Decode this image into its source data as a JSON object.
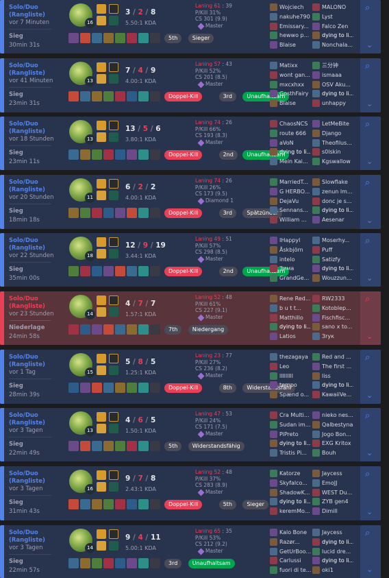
{
  "colors": {
    "win_bg": "#28344e",
    "loss_bg": "#59343b",
    "win_accent": "#5383e8",
    "loss_accent": "#e84057",
    "badge_red": "#e84057",
    "badge_grey": "#4a4b57",
    "badge_green": "#00a54e"
  },
  "icons": {
    "expand": "chevron-down-icon",
    "spy": "magnify-spy-icon"
  },
  "matches": [
    {
      "outcome": "win",
      "queue": "Solo/Duo",
      "queue2": "(Rangliste)",
      "ago": "vor 7 Minuten",
      "result": "Sieg",
      "duration": "30min 31s",
      "level": "16",
      "k": "3",
      "d": "2",
      "a": "8",
      "kda": "5.50:1 KDA",
      "lane_label": "Laning 61",
      "lane_rest": " : 39",
      "pkill": "P/Kill 31%",
      "cs": "CS 301 (9.9)",
      "rank": "Master",
      "tags": [
        {
          "label": "5th",
          "style": "grey"
        },
        {
          "label": "Sieger",
          "style": "grey"
        }
      ],
      "team1": [
        "Wojciech",
        "nakuhe790",
        "Emissary...",
        "hewwo p...",
        "Blaise"
      ],
      "team2": [
        "MALONO",
        "Lyst",
        "Falco Zen",
        "dying to li...",
        "Nonchala..."
      ],
      "me_index": 3
    },
    {
      "outcome": "win",
      "queue": "Solo/Duo",
      "queue2": "(Rangliste)",
      "ago": "vor 41 Minuten",
      "result": "Sieg",
      "duration": "23min 31s",
      "level": "13",
      "k": "7",
      "d": "4",
      "a": "9",
      "kda": "4.00:1 KDA",
      "lane_label": "Laning 57",
      "lane_rest": " : 43",
      "pkill": "P/Kill 52%",
      "cs": "CS 201 (8.5)",
      "rank": "Master",
      "tags": [
        {
          "label": "Doppel-Kill",
          "style": "red"
        },
        {
          "label": "3rd",
          "style": "grey"
        },
        {
          "label": "Unaufhaltsam",
          "style": "green"
        }
      ],
      "team1": [
        "Matixx",
        "wont gan...",
        "mxcxhxx",
        "GosthFairy",
        "Blaise"
      ],
      "team2": [
        "三分钟",
        "ismaaa",
        "OSV Aku...",
        "dying to li...",
        "unhappy"
      ],
      "me_index": 3
    },
    {
      "outcome": "win",
      "queue": "Solo/Duo",
      "queue2": "(Rangliste)",
      "ago": "vor 18 Stunden",
      "result": "Sieg",
      "duration": "23min 11s",
      "level": "13",
      "k": "13",
      "d": "5",
      "a": "6",
      "kda": "3.80:1 KDA",
      "lane_label": "Laning 74",
      "lane_rest": " : 26",
      "pkill": "P/Kill 66%",
      "cs": "CS 193 (8.3)",
      "rank": "Master",
      "tags": [
        {
          "label": "Doppel-Kill",
          "style": "red"
        },
        {
          "label": "2nd",
          "style": "grey"
        },
        {
          "label": "Unaufhaltsam",
          "style": "green"
        }
      ],
      "team1": [
        "ChaosNCS",
        "route 666",
        "aVoN",
        "dying to li...",
        "Mein Kai..."
      ],
      "team2": [
        "LetMeBite",
        "Django",
        "Theofilus...",
        "s0lskin",
        "Kgswallow"
      ],
      "me_index": 3
    },
    {
      "outcome": "win",
      "queue": "Solo/Duo",
      "queue2": "(Rangliste)",
      "ago": "vor 20 Stunden",
      "result": "Sieg",
      "duration": "18min 18s",
      "level": "11",
      "k": "6",
      "d": "2",
      "a": "2",
      "kda": "4.00:1 KDA",
      "lane_label": "Laning 74",
      "lane_rest": " : 26",
      "pkill": "P/Kill 26%",
      "cs": "CS 173 (9.5)",
      "rank": "Diamond 1",
      "tags": [
        {
          "label": "Doppel-Kill",
          "style": "red"
        },
        {
          "label": "3rd",
          "style": "grey"
        },
        {
          "label": "Spätzünder",
          "style": "grey"
        }
      ],
      "team1": [
        "MarriedT...",
        "G HERBO...",
        "DejaVu",
        "Sennans...",
        "William ..."
      ],
      "team2": [
        "Slowflake",
        "zenun lm...",
        "donc je s...",
        "dying to li...",
        "Aesenar"
      ],
      "me_index": 3
    },
    {
      "outcome": "win",
      "queue": "Solo/Duo",
      "queue2": "(Rangliste)",
      "ago": "vor 22 Stunden",
      "result": "Sieg",
      "duration": "35min 00s",
      "level": "18",
      "k": "12",
      "d": "9",
      "a": "19",
      "kda": "3.44:1 KDA",
      "lane_label": "Laning 49",
      "lane_rest": " : 51",
      "pkill": "P/Kill 57%",
      "cs": "CS 298 (8.5)",
      "rank": "Master",
      "tags": [
        {
          "label": "Doppel-Kill",
          "style": "red"
        },
        {
          "label": "2nd",
          "style": "grey"
        },
        {
          "label": "Unaufhaltsam",
          "style": "green"
        }
      ],
      "team1": [
        "IHappyl",
        "Åskbjörn",
        "intelo",
        "Зима",
        "GrandGe..."
      ],
      "team2": [
        "Moserhy...",
        "Puff",
        "Satizfy",
        "dying to li...",
        "Wouzzun..."
      ],
      "me_index": 3
    },
    {
      "outcome": "loss",
      "queue": "Solo/Duo",
      "queue2": "(Rangliste)",
      "ago": "vor 23 Stunden",
      "result": "Niederlage",
      "duration": "24min 58s",
      "level": "14",
      "k": "4",
      "d": "7",
      "a": "7",
      "kda": "1.57:1 KDA",
      "lane_label": "Laning 52",
      "lane_rest": " : 48",
      "pkill": "P/Kill 61%",
      "cs": "CS 227 (9.1)",
      "rank": "Master",
      "tags": [
        {
          "label": "7th",
          "style": "grey"
        },
        {
          "label": "Niedergang",
          "style": "grey"
        }
      ],
      "team1": [
        "Rene Red...",
        "b u t t...",
        "Matthillo",
        "dying to li...",
        "Latios"
      ],
      "team2": [
        "RW2333",
        "Kotoblep...",
        "Fischfisc...",
        "sano x to...",
        "Зrук"
      ],
      "me_index": 3
    },
    {
      "outcome": "win",
      "queue": "Solo/Duo",
      "queue2": "(Rangliste)",
      "ago": "vor 1 Tag",
      "result": "Sieg",
      "duration": "28min 39s",
      "level": "15",
      "k": "5",
      "d": "8",
      "a": "5",
      "kda": "1.25:1 KDA",
      "lane_label": "Laning 23",
      "lane_rest": " : 77",
      "pkill": "P/Kill 27%",
      "cs": "CS 236 (8.2)",
      "rank": "Master",
      "tags": [
        {
          "label": "Doppel-Kill",
          "style": "red"
        },
        {
          "label": "8th",
          "style": "grey"
        },
        {
          "label": "Widerstandsfähi",
          "style": "grey"
        }
      ],
      "team1": [
        "thezagaya",
        "Leo",
        "lllllllll",
        "tempo",
        "Spænd o..."
      ],
      "team2": [
        "Red and ...",
        "The first ...",
        "liss",
        "dying to li...",
        "KawaiiVe..."
      ],
      "me_index": 3
    },
    {
      "outcome": "win",
      "queue": "Solo/Duo",
      "queue2": "(Rangliste)",
      "ago": "vor 3 Tagen",
      "result": "Sieg",
      "duration": "22min 49s",
      "level": "13",
      "k": "4",
      "d": "6",
      "a": "5",
      "kda": "1.50:1 KDA",
      "lane_label": "Laning 47",
      "lane_rest": " : 53",
      "pkill": "P/Kill 24%",
      "cs": "CS 171 (7.5)",
      "rank": "Master",
      "tags": [
        {
          "label": "5th",
          "style": "grey"
        },
        {
          "label": "Widerstandsfähig",
          "style": "grey"
        }
      ],
      "team1": [
        "Cra Multi...",
        "Sudan im...",
        "PiPreto",
        "dying to li...",
        "Tristis Pi..."
      ],
      "team2": [
        "nieko nes...",
        "Qalbestyna",
        "Jogo Bon...",
        "EXG Kritox",
        "Bouh"
      ],
      "me_index": 3
    },
    {
      "outcome": "win",
      "queue": "Solo/Duo",
      "queue2": "(Rangliste)",
      "ago": "vor 3 Tagen",
      "result": "Sieg",
      "duration": "31min 43s",
      "level": "16",
      "k": "9",
      "d": "7",
      "a": "8",
      "kda": "2.43:1 KDA",
      "lane_label": "Laning 52",
      "lane_rest": " : 48",
      "pkill": "P/Kill 37%",
      "cs": "CS 283 (8.9)",
      "rank": "Master",
      "tags": [
        {
          "label": "Doppel-Kill",
          "style": "red"
        },
        {
          "label": "5th",
          "style": "grey"
        },
        {
          "label": "Sieger",
          "style": "grey"
        }
      ],
      "team1": [
        "Katorze",
        "Skyfalco...",
        "ShadowK...",
        "dying to li...",
        "keremMo..."
      ],
      "team2": [
        "Jaycess",
        "EmoJJ",
        "WEST Du...",
        "ZYB gen4",
        "Dimill"
      ],
      "me_index": 3
    },
    {
      "outcome": "win",
      "queue": "Solo/Duo",
      "queue2": "(Rangliste)",
      "ago": "vor 3 Tagen",
      "result": "Sieg",
      "duration": "22min 57s",
      "level": "14",
      "k": "9",
      "d": "4",
      "a": "11",
      "kda": "5.00:1 KDA",
      "lane_label": "Laning 65",
      "lane_rest": " : 35",
      "pkill": "P/Kill 53%",
      "cs": "CS 212 (9.2)",
      "rank": "Master",
      "tags": [
        {
          "label": "3rd",
          "style": "grey"
        },
        {
          "label": "Unaufhaltsam",
          "style": "green"
        }
      ],
      "team1": [
        "Kalo Bone",
        "Razør...",
        "GetUrBoo...",
        "Carlussi",
        "fuori di te..."
      ],
      "team2": [
        "Jaycess",
        "dying to li...",
        "lucid dre...",
        "dying to li...",
        "oki1"
      ],
      "me_index": 3
    }
  ]
}
